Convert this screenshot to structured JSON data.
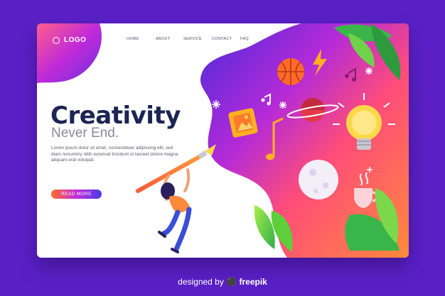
{
  "brand": {
    "logo_text": "LOGO"
  },
  "nav": {
    "items": [
      "HOME",
      "ABOUT",
      "SERVICE",
      "CONTACT",
      "FAQ"
    ]
  },
  "hero": {
    "title": "Creativity",
    "subtitle": "Never End.",
    "body": "Lorem ipsum dolor sit amet, consectetuer adipiscing elit, sed diam nonummy nibh euismod tincidunt ut laoreet dolore magna aliquam erat volutpat.",
    "cta_label": "READ MORE"
  },
  "footer": {
    "credit_prefix": "designed by",
    "credit_brand": "freepik"
  },
  "colors": {
    "background": "#5a20c6",
    "title": "#1c2552",
    "accent_orange": "#ff6a2a",
    "accent_purple": "#c42bdc",
    "accent_green": "#5ccf3a"
  },
  "icons": [
    "basketball-icon",
    "lightning-icon",
    "music-note-icon",
    "leaf-icon",
    "image-icon",
    "planet-icon",
    "lightbulb-icon",
    "moon-icon",
    "coffee-cup-icon",
    "paintbrush-icon",
    "sparkle-icon"
  ]
}
